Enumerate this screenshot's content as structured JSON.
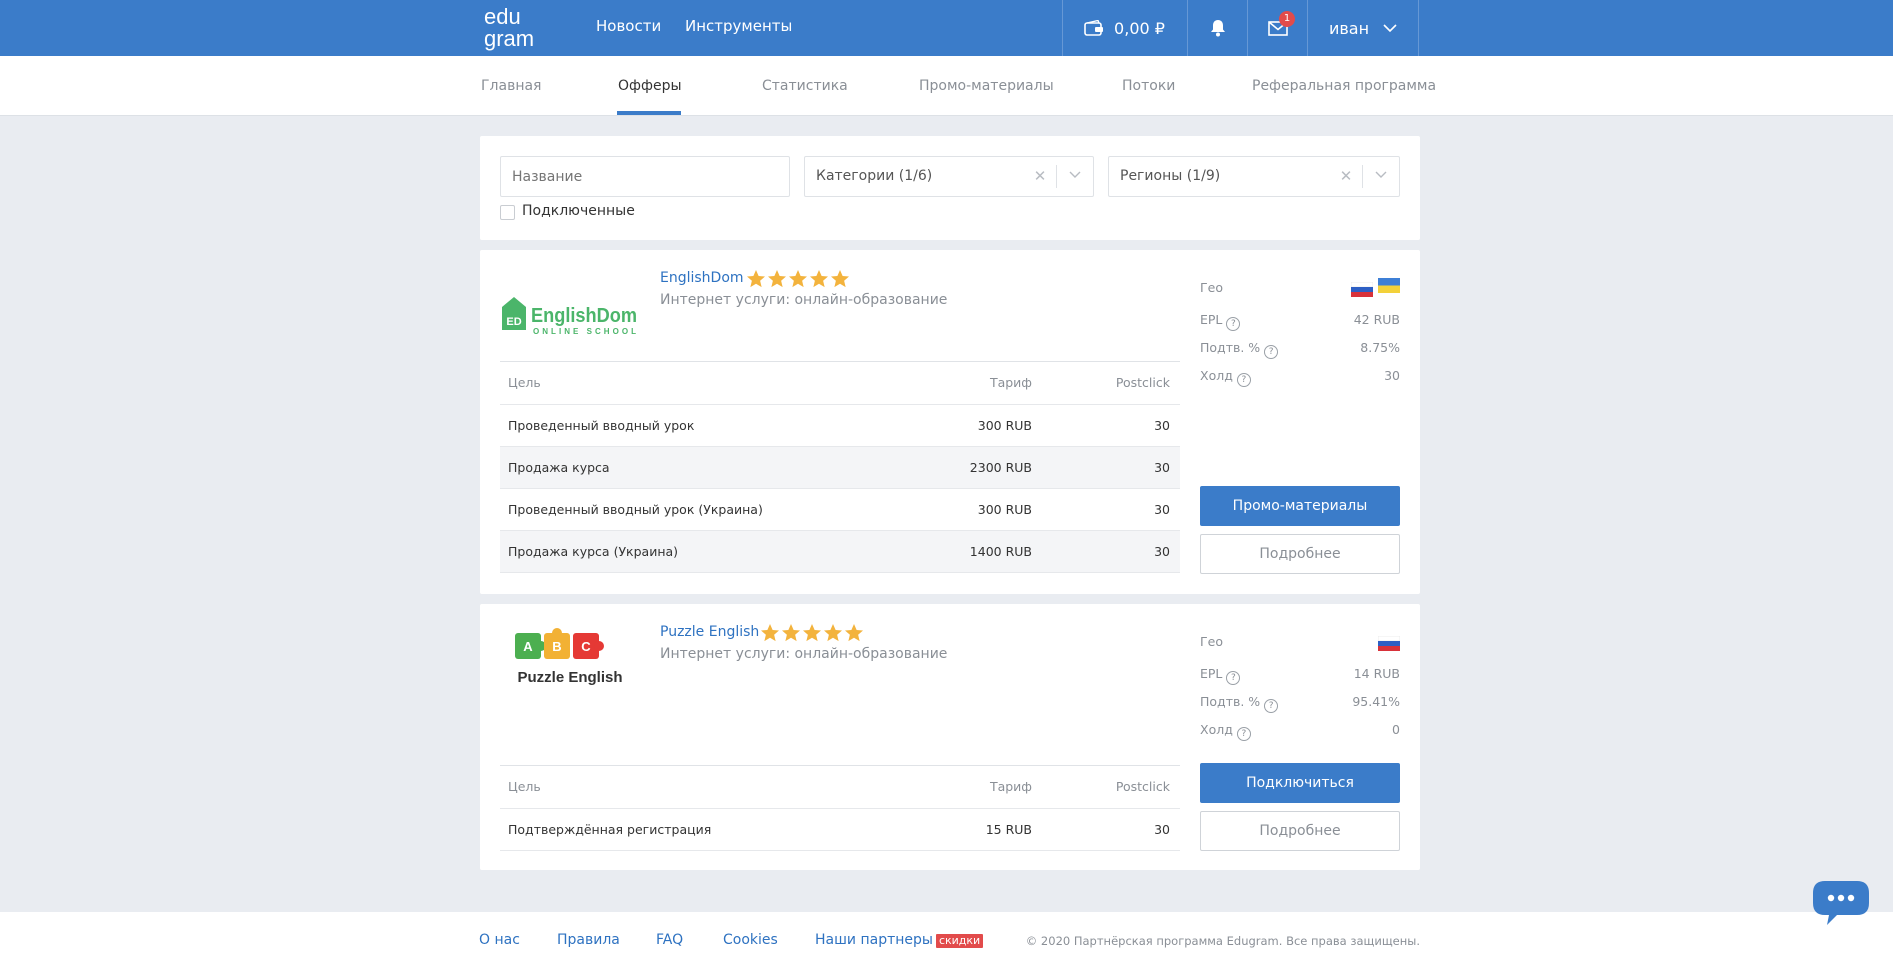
{
  "brand": {
    "logo_line1": "edu",
    "logo_line2": "gram",
    "color": "#3b7cc9"
  },
  "topnav": {
    "news": "Новости",
    "tools": "Инструменты"
  },
  "balance": {
    "amount": "0,00 ₽",
    "icon": "wallet-icon"
  },
  "notifications": {
    "icon": "bell-icon"
  },
  "messages": {
    "icon": "mail-icon",
    "badge": "1"
  },
  "user": {
    "name": "иван",
    "icon": "chevron-down-icon"
  },
  "subnav": {
    "active_index": 1,
    "items": [
      "Главная",
      "Офферы",
      "Статистика",
      "Промо-материалы",
      "Потоки",
      "Реферальная программа"
    ]
  },
  "filters": {
    "name_placeholder": "Название",
    "categories": "Категории (1/6)",
    "regions": "Регионы (1/9)",
    "connected_label": "Подключенные",
    "connected_checked": false
  },
  "table_headers": {
    "goal": "Цель",
    "rate": "Тариф",
    "postclick": "Postclick"
  },
  "side_labels": {
    "geo": "Гео",
    "epl": "EPL",
    "approve": "Подтв. %",
    "hold": "Холд"
  },
  "offers": [
    {
      "name": "EnglishDom",
      "logo_text": "EnglishDom",
      "logo_sub": "ONLINE SCHOOL",
      "logo_badge": "ED",
      "rating": 5,
      "category": "Интернет услуги: онлайн-образование",
      "geo_flags": [
        "ru",
        "ua"
      ],
      "epl": "42 RUB",
      "approve": "8.75%",
      "hold": "30",
      "rows": [
        {
          "goal": "Проведенный вводный урок",
          "rate": "300 RUB",
          "postclick": "30"
        },
        {
          "goal": "Продажа курса",
          "rate": "2300 RUB",
          "postclick": "30"
        },
        {
          "goal": "Проведенный вводный урок (Украина)",
          "rate": "300 RUB",
          "postclick": "30"
        },
        {
          "goal": "Продажа курса (Украина)",
          "rate": "1400 RUB",
          "postclick": "30"
        }
      ],
      "primary_button": "Промо-материалы",
      "secondary_button": "Подробнее"
    },
    {
      "name": "Puzzle English",
      "logo_text": "Puzzle English",
      "logo_letters": [
        "A",
        "B",
        "C"
      ],
      "rating": 5,
      "category": "Интернет услуги: онлайн-образование",
      "geo_flags": [
        "ru"
      ],
      "epl": "14 RUB",
      "approve": "95.41%",
      "hold": "0",
      "rows": [
        {
          "goal": "Подтверждённая регистрация",
          "rate": "15 RUB",
          "postclick": "30"
        }
      ],
      "primary_button": "Подключиться",
      "secondary_button": "Подробнее"
    }
  ],
  "footer": {
    "links": [
      "О нас",
      "Правила",
      "FAQ",
      "Cookies",
      "Наши партнеры"
    ],
    "partners_tag": "скидки",
    "copyright": "© 2020 Партнёрская программа Edugram. Все права защищены."
  },
  "chat": {
    "icon": "chat-bubble-icon"
  }
}
